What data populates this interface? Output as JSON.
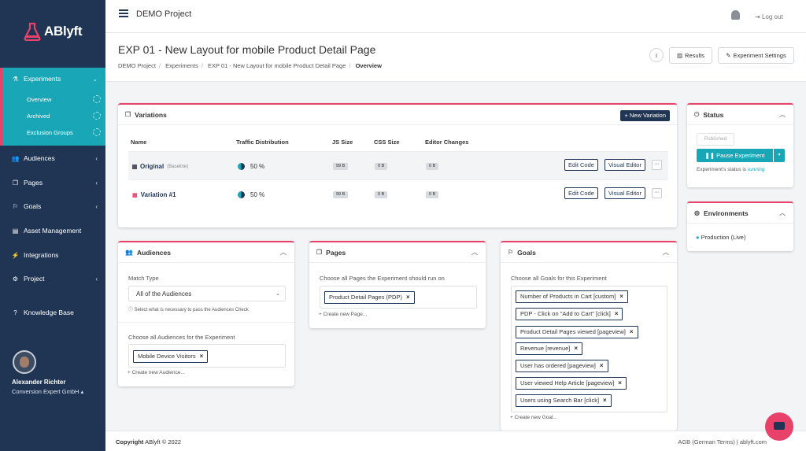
{
  "brand": {
    "name": "ABlyft",
    "accent": "#19a7b7",
    "primary": "#1f3553",
    "highlight": "#e8426b"
  },
  "sidebar": {
    "items": [
      {
        "label": "Experiments",
        "icon": "flask-icon"
      },
      {
        "label": "Audiences",
        "icon": "users-icon"
      },
      {
        "label": "Pages",
        "icon": "pages-icon"
      },
      {
        "label": "Goals",
        "icon": "flag-icon"
      },
      {
        "label": "Asset Management",
        "icon": "briefcase-icon"
      },
      {
        "label": "Integrations",
        "icon": "plug-icon"
      },
      {
        "label": "Project",
        "icon": "gear-icon"
      },
      {
        "label": "Knowledge Base",
        "icon": "help-icon"
      }
    ],
    "sub_items": [
      "Overview",
      "Archived",
      "Exclusion Groups"
    ],
    "user": {
      "name": "Alexander Richter",
      "company": "Conversion Expert GmbH"
    }
  },
  "topbar": {
    "project": "DEMO Project",
    "logout": "Log out"
  },
  "header": {
    "title": "EXP 01 - New Layout for mobile Product Detail Page",
    "breadcrumbs": [
      "DEMO Project",
      "Experiments",
      "EXP 01 - New Layout for mobile Product Detail Page",
      "Overview"
    ],
    "info": "i",
    "results": "Results",
    "settings": "Experiment Settings"
  },
  "variations": {
    "title": "Variations",
    "new_button": "New Variation",
    "columns": [
      "Name",
      "Traffic Distribution",
      "JS Size",
      "CSS Size",
      "Editor Changes"
    ],
    "rows": [
      {
        "name": "Original",
        "tag": "(Baseline)",
        "traffic": "50 %",
        "js": "99 B",
        "css": "0 B",
        "changes": "0 B",
        "traffic_pct": 50
      },
      {
        "name": "Variation #1",
        "tag": "",
        "traffic": "50 %",
        "js": "99 B",
        "css": "0 B",
        "changes": "0 B",
        "traffic_pct": 50
      }
    ],
    "edit_code": "Edit Code",
    "visual_editor": "Visual Editor",
    "more": "···"
  },
  "audiences": {
    "title": "Audiences",
    "match_label": "Match Type",
    "match_value": "All of the Audiences",
    "hint": "Select what is necessary to pass the Audiences Check",
    "choose_label": "Choose all Audiences for the Experiment",
    "tags": [
      "Mobile Device Visitors"
    ],
    "create": "+ Create new Audience..."
  },
  "pages": {
    "title": "Pages",
    "choose_label": "Choose all Pages the Experiment should run on",
    "tags": [
      "Product Detail Pages (PDP)"
    ],
    "create": "+ Create new Page..."
  },
  "goals": {
    "title": "Goals",
    "choose_label": "Choose all Goals for this Experiment",
    "tags": [
      "Number of Products in Cart [custom]",
      "PDP - Click on \"Add to Cart\" [click]",
      "Product Detail Pages viewed [pageview]",
      "Revenue [revenue]",
      "User has ordered [pageview]",
      "User viewed Help Article [pageview]",
      "Users using Search Bar [click]"
    ],
    "create": "+ Create new Goal..."
  },
  "status": {
    "title": "Status",
    "published": "Published",
    "pause": "Pause Experiment",
    "text_prefix": "Experiment's status is",
    "text_value": "running"
  },
  "environments": {
    "title": "Environments",
    "items": [
      "Production (Live)"
    ]
  },
  "footer": {
    "left_bold": "Copyright",
    "left": "ABlyft © 2022",
    "right": "AGB (German Terms) | ablyft.com"
  }
}
